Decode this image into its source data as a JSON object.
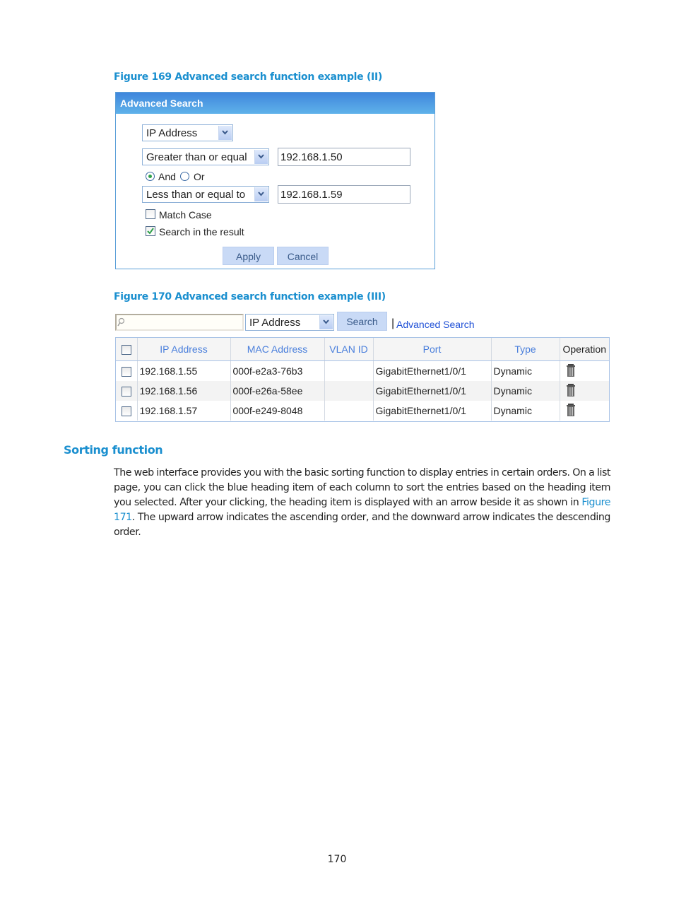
{
  "figure169": {
    "caption": "Figure 169 Advanced search function example (II)",
    "panel_title": "Advanced Search",
    "field_select": "IP Address",
    "condition1": {
      "operator": "Greater than or equal",
      "value": "192.168.1.50"
    },
    "logic": {
      "options": [
        "And",
        "Or"
      ],
      "selected": "And"
    },
    "condition2": {
      "operator": "Less than or equal to",
      "value": "192.168.1.59"
    },
    "match_case": {
      "label": "Match Case",
      "checked": false
    },
    "search_in_result": {
      "label": "Search in the result",
      "checked": true
    },
    "apply_label": "Apply",
    "cancel_label": "Cancel"
  },
  "figure170": {
    "caption": "Figure 170 Advanced search function example (III)",
    "search_value": "",
    "field_select": "IP Address",
    "search_label": "Search",
    "separator": "|",
    "advanced_search_link": "Advanced Search",
    "table": {
      "columns": [
        "",
        "IP Address",
        "MAC Address",
        "VLAN ID",
        "Port",
        "Type",
        "Operation"
      ],
      "rows": [
        {
          "ip": "192.168.1.55",
          "mac": "000f-e2a3-76b3",
          "vlan": "",
          "port": "GigabitEthernet1/0/1",
          "type": "Dynamic",
          "operation": "delete-icon"
        },
        {
          "ip": "192.168.1.56",
          "mac": "000f-e26a-58ee",
          "vlan": "",
          "port": "GigabitEthernet1/0/1",
          "type": "Dynamic",
          "operation": "delete-icon"
        },
        {
          "ip": "192.168.1.57",
          "mac": "000f-e249-8048",
          "vlan": "",
          "port": "GigabitEthernet1/0/1",
          "type": "Dynamic",
          "operation": "delete-icon"
        }
      ]
    }
  },
  "section": {
    "heading": "Sorting function",
    "para_part1": "The web interface provides you with the basic sorting function to display entries in certain orders. On a list page, you can click the blue heading item of each column to sort the entries based on the heading item you selected. After your clicking, the heading item is displayed with an arrow beside it as shown in ",
    "para_link": "Figure 171",
    "para_part2": ". The upward arrow indicates the ascending order, and the downward arrow indicates the descending order."
  },
  "page_number": "170"
}
